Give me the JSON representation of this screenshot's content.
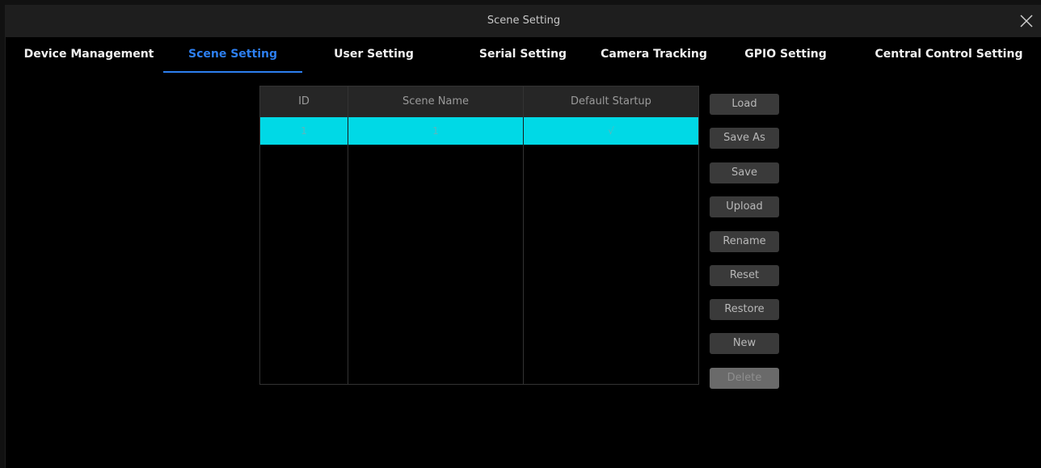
{
  "window": {
    "title": "Scene Setting"
  },
  "tabs": [
    {
      "label": "Device Management"
    },
    {
      "label": "Scene Setting"
    },
    {
      "label": "User Setting"
    },
    {
      "label": "Serial Setting"
    },
    {
      "label": "Camera Tracking"
    },
    {
      "label": "GPIO Setting"
    },
    {
      "label": "Central Control Setting"
    }
  ],
  "active_tab": "Scene Setting",
  "table": {
    "headers": {
      "id": "ID",
      "name": "Scene Name",
      "default": "Default Startup"
    },
    "rows": [
      {
        "id": "1",
        "name": "1",
        "default": "√",
        "selected": true
      }
    ]
  },
  "buttons": {
    "load": "Load",
    "save_as": "Save As",
    "save": "Save",
    "upload": "Upload",
    "rename": "Rename",
    "reset": "Reset",
    "restore": "Restore",
    "new": "New",
    "delete": "Delete"
  },
  "colors": {
    "accent": "#2d7ff0",
    "selected_row": "#00d9e6",
    "button_bg": "#3a3a3a",
    "button_disabled_bg": "#6a6a6a"
  },
  "icons": {
    "close": "close-icon"
  }
}
